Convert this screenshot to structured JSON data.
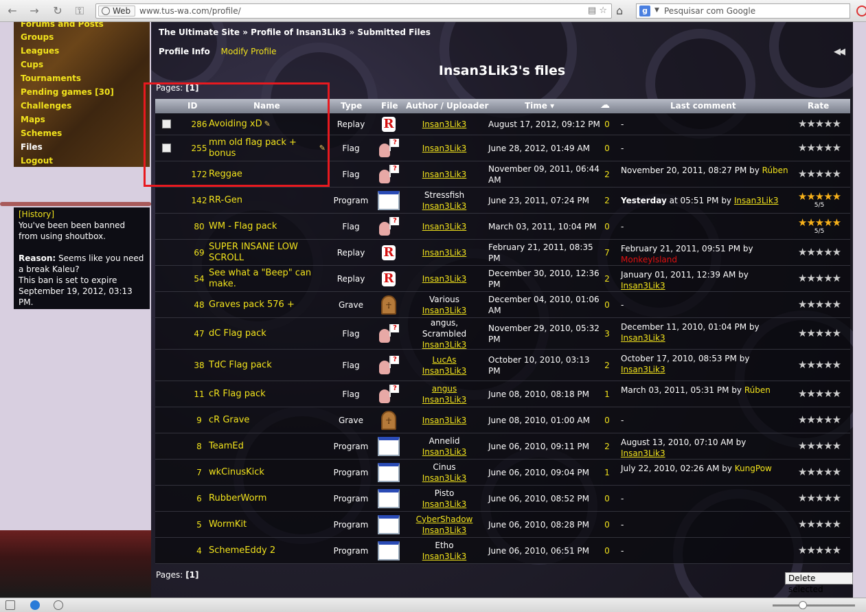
{
  "browser": {
    "chip_label": "Web",
    "url": "www.tus-wa.com/profile/",
    "search_placeholder": "Pesquisar com Google",
    "search_engine_letter": "g"
  },
  "menu": {
    "items": [
      {
        "label": "Forums and Posts"
      },
      {
        "label": "Groups"
      },
      {
        "label": "Leagues"
      },
      {
        "label": "Cups"
      },
      {
        "label": "Tournaments"
      },
      {
        "label": "Pending games [30]"
      },
      {
        "label": "Challenges"
      },
      {
        "label": "Maps"
      },
      {
        "label": "Schemes"
      },
      {
        "label": "Files"
      },
      {
        "label": "Logout"
      }
    ]
  },
  "shoutbox": {
    "history_link": "[History]",
    "message": "You've been been banned from using shoutbox.",
    "reason_label": "Reason:",
    "reason_text": "Seems like you need a break Kaleu?",
    "expire_text": "This ban is set to expire September 19, 2012, 03:13 PM."
  },
  "breadcrumb": "The Ultimate Site » Profile of Insan3Lik3 » Submitted Files",
  "tabs": {
    "profile_info": "Profile Info",
    "modify_profile": "Modify Profile"
  },
  "page_title": "Insan3Lik3's files",
  "pages_label": "Pages:",
  "pages_value": "[1]",
  "delete_button": "Delete selected",
  "columns": {
    "id": "ID",
    "name": "Name",
    "type": "Type",
    "file": "File",
    "author": "Author / Uploader",
    "time": "Time ▾",
    "last_comment": "Last comment",
    "rate": "Rate"
  },
  "colors": {
    "accent_yellow": "#f2e31c",
    "highlight_box": "#e8191f",
    "red_user": "#e01010"
  },
  "files": [
    {
      "id": "286",
      "name": "Avoiding xD",
      "type": "Replay",
      "icon": "replay-icon",
      "authors": [],
      "uploader": "Insan3Lik3",
      "time": "August 17, 2012, 09:12 PM",
      "comments": "0",
      "last_comment": "-",
      "checkbox": true,
      "editable": true
    },
    {
      "id": "255",
      "name": "mm old flag pack + bonus",
      "type": "Flag",
      "icon": "flag-icon",
      "authors": [],
      "uploader": "Insan3Lik3",
      "time": "June 28, 2012, 01:49 AM",
      "comments": "0",
      "last_comment": "-",
      "checkbox": true,
      "editable": true
    },
    {
      "id": "172",
      "name": "Reggae",
      "type": "Flag",
      "icon": "flag-icon",
      "authors": [],
      "uploader": "Insan3Lik3",
      "time": "November 09, 2011, 06:44 AM",
      "comments": "2",
      "last_comment": "November 20, 2011, 08:27 PM by",
      "last_user": "Rúben",
      "last_user_style": "y"
    },
    {
      "id": "142",
      "name": "RR-Gen",
      "type": "Program",
      "icon": "program-icon",
      "authors": [
        "Stressfish"
      ],
      "uploader": "Insan3Lik3",
      "time": "June 23, 2011, 07:24 PM",
      "comments": "2",
      "last_comment_bold": "Yesterday",
      "last_comment": "at 05:51 PM by",
      "last_user": "Insan3Lik3",
      "last_user_style": "u",
      "rating": 5,
      "rating_text": "5/5"
    },
    {
      "id": "80",
      "name": "WM - Flag pack",
      "type": "Flag",
      "icon": "flag-icon",
      "authors": [],
      "uploader": "Insan3Lik3",
      "time": "March 03, 2011, 10:04 PM",
      "comments": "0",
      "last_comment": "-",
      "rating": 5,
      "rating_text": "5/5"
    },
    {
      "id": "69",
      "name": "SUPER INSANE LOW SCROLL",
      "type": "Replay",
      "icon": "replay-icon",
      "authors": [],
      "uploader": "Insan3Lik3",
      "time": "February 21, 2011, 08:35 PM",
      "comments": "7",
      "last_comment": "February 21, 2011, 09:51 PM by",
      "last_user": "MonkeyIsland",
      "last_user_style": "r"
    },
    {
      "id": "54",
      "name": "See what a \"Beep\" can make.",
      "type": "Replay",
      "icon": "replay-icon",
      "authors": [],
      "uploader": "Insan3Lik3",
      "time": "December 30, 2010, 12:36 PM",
      "comments": "2",
      "last_comment": "January 01, 2011, 12:39 AM by",
      "last_user": "Insan3Lik3",
      "last_user_style": "u"
    },
    {
      "id": "48",
      "name": "Graves pack 576 +",
      "type": "Grave",
      "icon": "grave-icon",
      "authors": [
        "Various"
      ],
      "uploader": "Insan3Lik3",
      "time": "December 04, 2010, 01:06 AM",
      "comments": "0",
      "last_comment": "-"
    },
    {
      "id": "47",
      "name": "dC Flag pack",
      "type": "Flag",
      "icon": "flag-icon",
      "authors": [
        "angus,",
        "Scrambled"
      ],
      "uploader": "Insan3Lik3",
      "time": "November 29, 2010, 05:32 PM",
      "comments": "3",
      "last_comment": "December 11, 2010, 01:04 PM by",
      "last_user": "Insan3Lik3",
      "last_user_style": "u"
    },
    {
      "id": "38",
      "name": "TdC Flag pack",
      "type": "Flag",
      "icon": "flag-icon",
      "authors_linked": [
        "LucAs"
      ],
      "uploader": "Insan3Lik3",
      "time": "October 10, 2010, 03:13 PM",
      "comments": "2",
      "last_comment": "October 17, 2010, 08:53 PM by",
      "last_user": "Insan3Lik3",
      "last_user_style": "u"
    },
    {
      "id": "11",
      "name": "cR Flag pack",
      "type": "Flag",
      "icon": "flag-icon",
      "authors_linked": [
        "angus"
      ],
      "uploader": "Insan3Lik3",
      "time": "June 08, 2010, 08:18 PM",
      "comments": "1",
      "last_comment": "March 03, 2011, 05:31 PM by",
      "last_user": "Rúben",
      "last_user_style": "y"
    },
    {
      "id": "9",
      "name": "cR Grave",
      "type": "Grave",
      "icon": "grave-icon",
      "authors": [],
      "uploader": "Insan3Lik3",
      "time": "June 08, 2010, 01:00 AM",
      "comments": "0",
      "last_comment": "-"
    },
    {
      "id": "8",
      "name": "TeamEd",
      "type": "Program",
      "icon": "program-icon",
      "authors": [
        "Annelid"
      ],
      "uploader": "Insan3Lik3",
      "time": "June 06, 2010, 09:11 PM",
      "comments": "2",
      "last_comment": "August 13, 2010, 07:10 AM by",
      "last_user": "Insan3Lik3",
      "last_user_style": "u"
    },
    {
      "id": "7",
      "name": "wkCinusKick",
      "type": "Program",
      "icon": "program-icon",
      "authors": [
        "Cinus"
      ],
      "uploader": "Insan3Lik3",
      "time": "June 06, 2010, 09:04 PM",
      "comments": "1",
      "last_comment": "July 22, 2010, 02:26 AM by",
      "last_user": "KungPow",
      "last_user_style": "y"
    },
    {
      "id": "6",
      "name": "RubberWorm",
      "type": "Program",
      "icon": "program-icon",
      "authors": [
        "Pisto"
      ],
      "uploader": "Insan3Lik3",
      "time": "June 06, 2010, 08:52 PM",
      "comments": "0",
      "last_comment": "-"
    },
    {
      "id": "5",
      "name": "WormKit",
      "type": "Program",
      "icon": "program-icon",
      "authors_linked": [
        "CyberShadow"
      ],
      "uploader": "Insan3Lik3",
      "time": "June 06, 2010, 08:28 PM",
      "comments": "0",
      "last_comment": "-"
    },
    {
      "id": "4",
      "name": "SchemeEddy 2",
      "type": "Program",
      "icon": "program-icon",
      "authors": [
        "Etho"
      ],
      "uploader": "Insan3Lik3",
      "time": "June 06, 2010, 06:51 PM",
      "comments": "0",
      "last_comment": "-"
    }
  ]
}
